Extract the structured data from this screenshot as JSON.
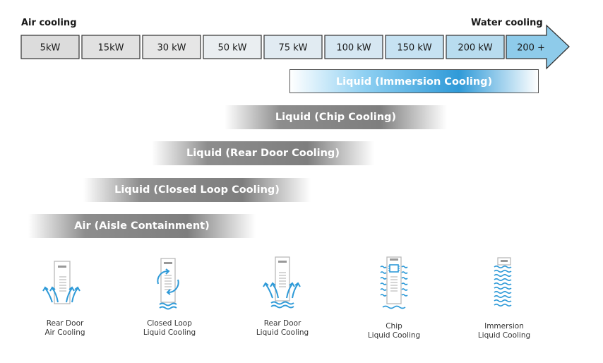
{
  "header": {
    "left": "Air cooling",
    "right": "Water cooling"
  },
  "scale": {
    "segments": [
      {
        "label": "5kW",
        "fill": "#dcdcdc"
      },
      {
        "label": "15kW",
        "fill": "#e1e1e1"
      },
      {
        "label": "30 kW",
        "fill": "#e6e6e6"
      },
      {
        "label": "50 kW",
        "fill": "#eaeef1"
      },
      {
        "label": "75 kW",
        "fill": "#e1ebf2"
      },
      {
        "label": "100 kW",
        "fill": "#d6e7f2"
      },
      {
        "label": "150 kW",
        "fill": "#c6e2f2"
      },
      {
        "label": "200 kW",
        "fill": "#b8dcef"
      },
      {
        "label": "200 +",
        "fill": "#9ccfea"
      }
    ],
    "arrow_color": "#8ecbea",
    "border_color": "#333333"
  },
  "bands": [
    {
      "label": "Liquid (Immersion Cooling)",
      "text_color": "#ffffff"
    },
    {
      "label": "Liquid (Chip Cooling)"
    },
    {
      "label": "Liquid (Rear Door Cooling)"
    },
    {
      "label": "Liquid (Closed Loop Cooling)"
    },
    {
      "label": "Air (Aisle Containment)"
    }
  ],
  "colors": {
    "accent_blue": "#2e9ad8",
    "band_gray": "#8a8a8a",
    "rack_gray": "#b5b5b5"
  },
  "icons": [
    {
      "name": "rear-door-air",
      "line1": "Rear Door",
      "line2": "Air Cooling"
    },
    {
      "name": "closed-loop-liquid",
      "line1": "Closed Loop",
      "line2": "Liquid Cooling"
    },
    {
      "name": "rear-door-liquid",
      "line1": "Rear Door",
      "line2": "Liquid Cooling"
    },
    {
      "name": "chip-liquid",
      "line1": "Chip",
      "line2": "Liquid Cooling"
    },
    {
      "name": "immersion-liquid",
      "line1": "Immersion",
      "line2": "Liquid Cooling"
    }
  ]
}
